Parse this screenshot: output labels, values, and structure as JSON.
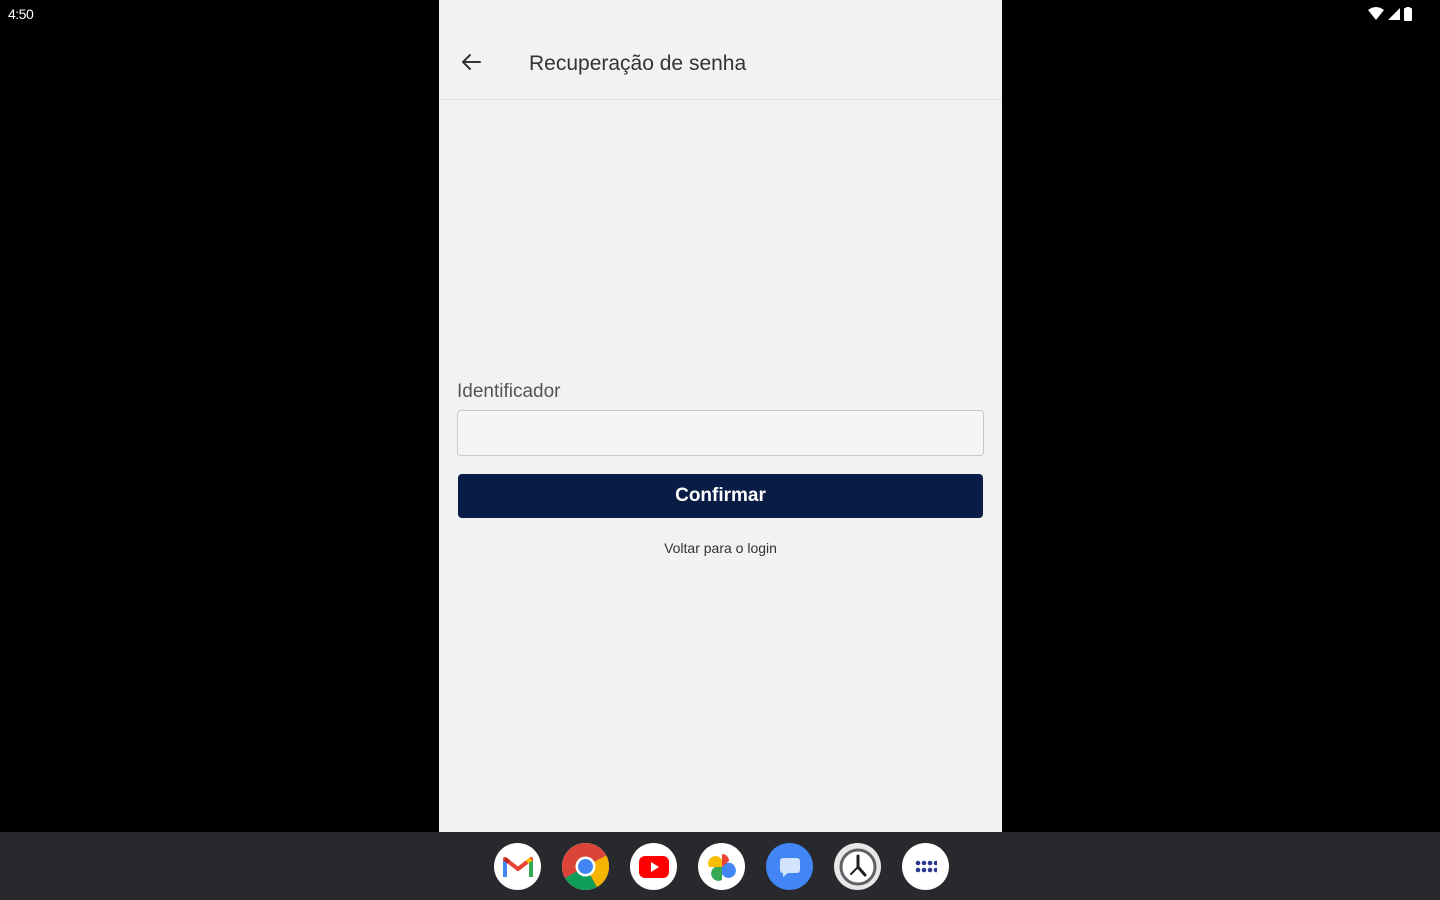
{
  "status_bar": {
    "time": "4:50"
  },
  "app": {
    "title": "Recuperação de senha",
    "back_icon": "arrow-back-icon",
    "form": {
      "identifier_label": "Identificador",
      "identifier_value": "",
      "confirm_label": "Confirmar",
      "back_to_login_label": "Voltar para o login"
    },
    "colors": {
      "primary": "#081c45",
      "background": "#f2f2f2"
    }
  },
  "taskbar": {
    "apps": [
      {
        "name": "gmail-icon"
      },
      {
        "name": "chrome-icon"
      },
      {
        "name": "youtube-icon"
      },
      {
        "name": "photos-icon"
      },
      {
        "name": "messages-icon"
      },
      {
        "name": "clock-icon"
      },
      {
        "name": "app-launcher-icon"
      }
    ]
  }
}
